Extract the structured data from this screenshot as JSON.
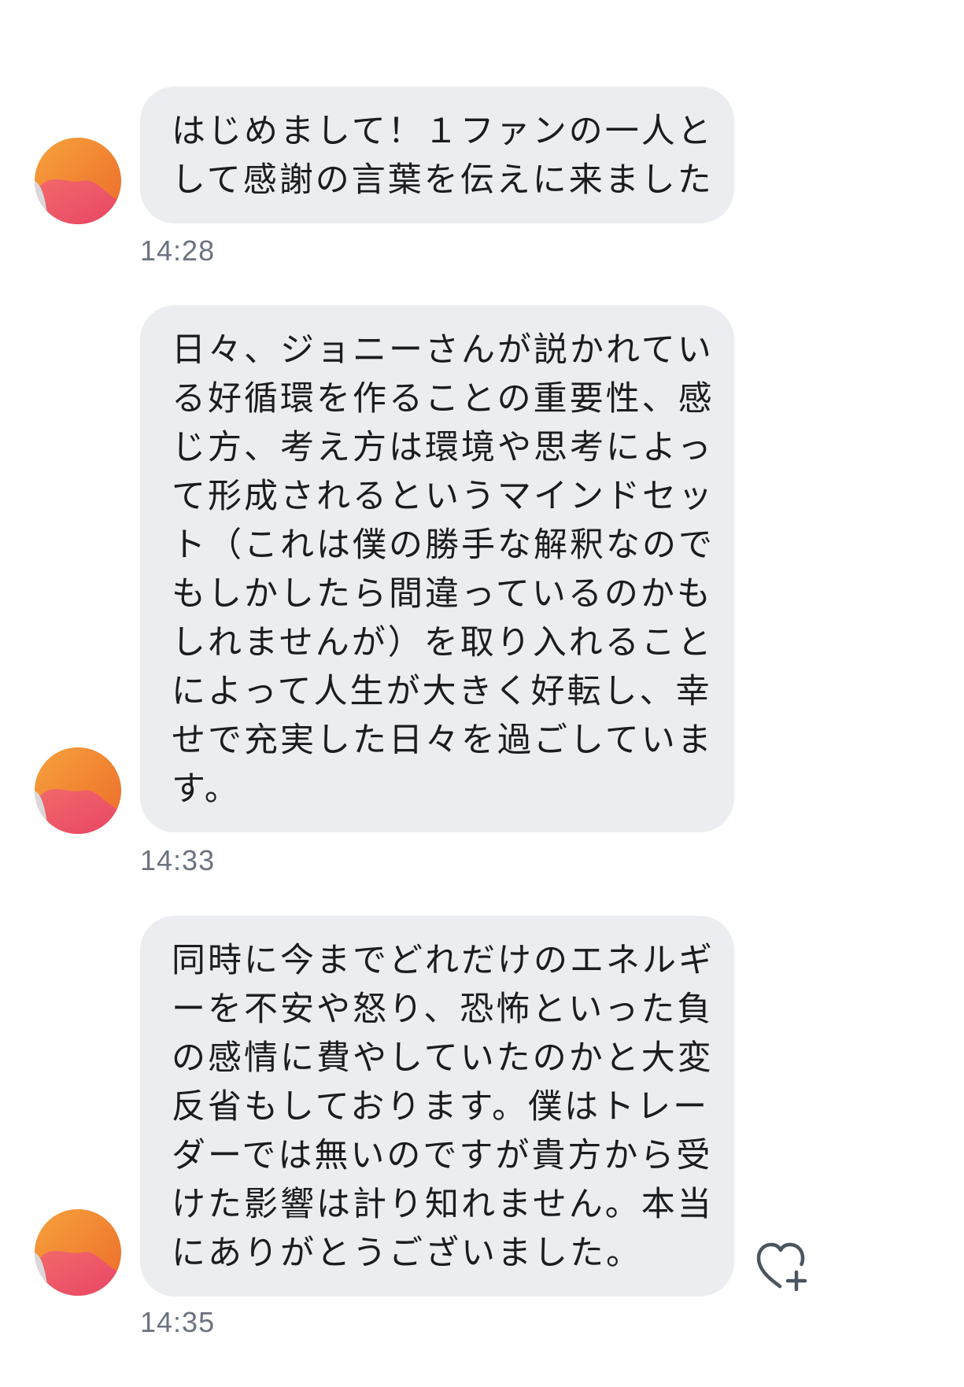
{
  "colors": {
    "bubble_bg": "#ecedf0",
    "text": "#1c1c1e",
    "timestamp": "#6b7280",
    "avatar_orange": "#f28a2e",
    "avatar_pink": "#ef5a6e",
    "heart_icon": "#4a5560"
  },
  "messages": [
    {
      "lines": [
        "はじめまして！１ファンの一人と",
        "して感謝の言葉を伝えに来ました"
      ],
      "time": "14:28"
    },
    {
      "lines": [
        "日々、ジョニーさんが説かれてい",
        "る好循環を作ることの重要性、感",
        "じ方、考え方は環境や思考によっ",
        "て形成されるというマインドセッ",
        "ト（これは僕の勝手な解釈なので",
        "もしかしたら間違っているのかも",
        "しれませんが）を取り入れること",
        "によって人生が大きく好転し、幸",
        "せで充実した日々を過ごしていま",
        "す。"
      ],
      "time": "14:33"
    },
    {
      "lines": [
        "同時に今までどれだけのエネルギ",
        "ーを不安や怒り、恐怖といった負",
        "の感情に費やしていたのかと大変",
        "反省もしております。僕はトレー",
        "ダーでは無いのですが貴方から受",
        "けた影響は計り知れません。本当",
        "にありがとうございました。"
      ],
      "time": "14:35"
    }
  ],
  "icons": {
    "avatar": "avatar-gradient-icon",
    "like": "heart-plus-icon"
  }
}
